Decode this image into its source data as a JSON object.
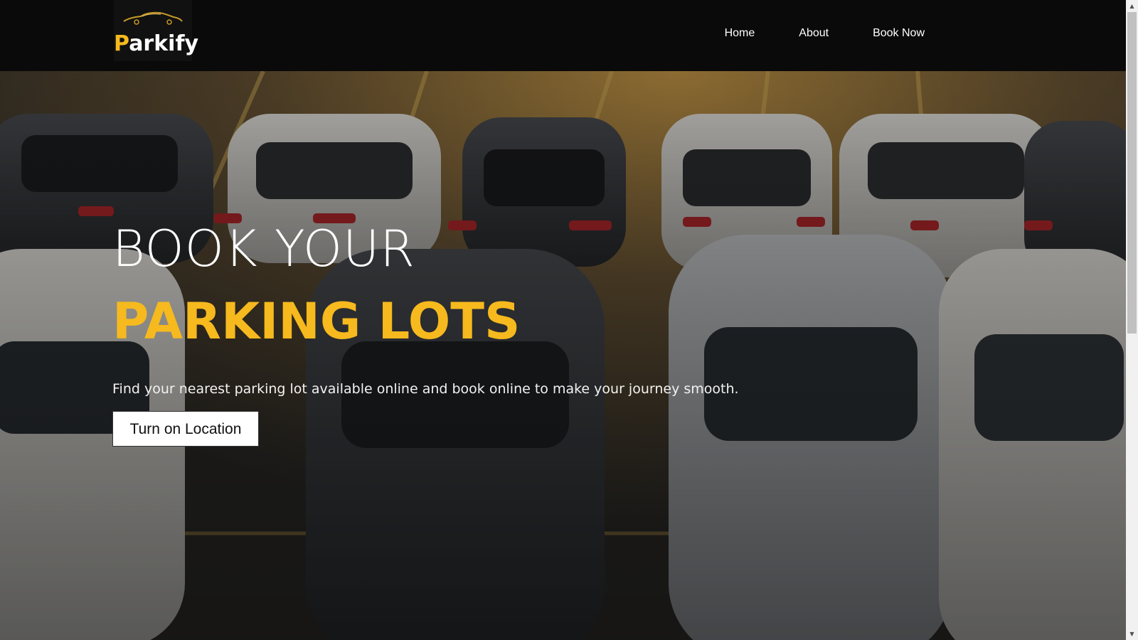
{
  "nav": {
    "logo_initial": "P",
    "logo_rest": "arkify",
    "links": [
      {
        "label": "Home"
      },
      {
        "label": "About"
      },
      {
        "label": "Book Now"
      }
    ]
  },
  "hero": {
    "line1": "BOOK YOUR",
    "line2": "PARKING LOTS",
    "subtitle": "Find your nearest parking lot available online and book online to make your journey smooth.",
    "button_label": "Turn on Location",
    "background_image": "parking-lot-cars-photo"
  },
  "colors": {
    "accent": "#f6b91e",
    "navbar_bg": "#0a0a0a",
    "text": "#ffffff"
  },
  "icons": {
    "logo": "car-silhouette-icon",
    "scroll_up": "triangle-up-icon",
    "scroll_down": "triangle-down-icon"
  }
}
